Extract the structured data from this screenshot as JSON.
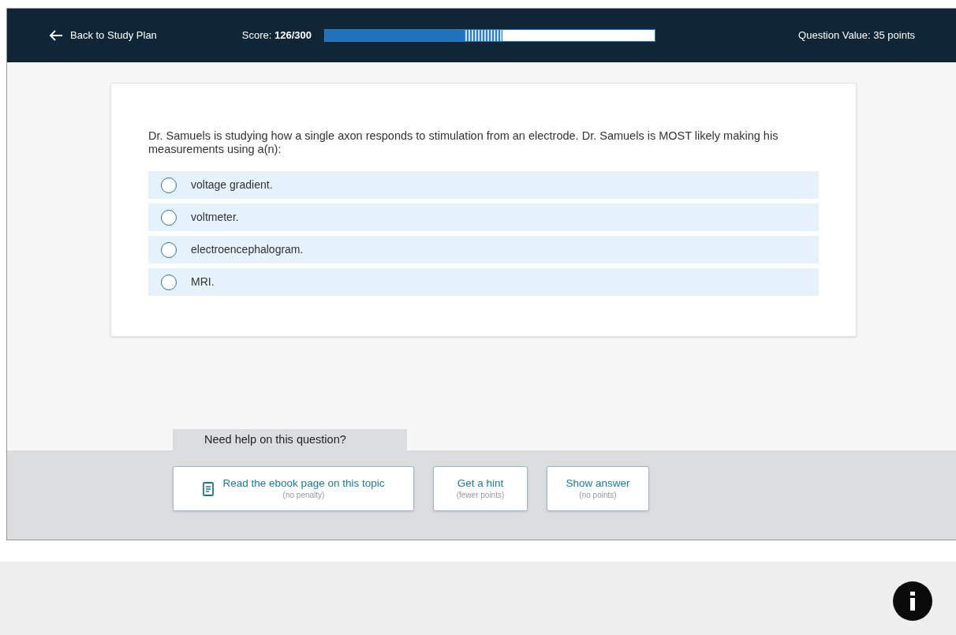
{
  "header": {
    "back_link": "Back to Study Plan",
    "score_label": "Score:",
    "score_value": "126/300",
    "score_bar": {
      "level": 0.42
    },
    "potential_bar": {
      "level": 0.537
    },
    "question_value": "Question Value: 35 points"
  },
  "question": {
    "prompt": "Dr. Samuels is studying how a single axon responds to stimulation from an electrode. Dr. Samuels is MOST likely making his measurements using a(n):",
    "options": [
      {
        "label": "voltage gradient.",
        "selected": false
      },
      {
        "label": "voltmeter.",
        "selected": false
      },
      {
        "label": "electroencephalogram.",
        "selected": false
      },
      {
        "label": "MRI.",
        "selected": false
      }
    ]
  },
  "help": {
    "title": "Need help on this question?",
    "buttons": [
      {
        "kind": "ebook",
        "label": "Read the ebook page on this topic",
        "note": "(no penalty)"
      },
      {
        "kind": "plain",
        "label": "Get a hint",
        "note": "(fewer points)"
      },
      {
        "kind": "plain",
        "label": "Show answer",
        "note": "(no points)"
      }
    ]
  }
}
